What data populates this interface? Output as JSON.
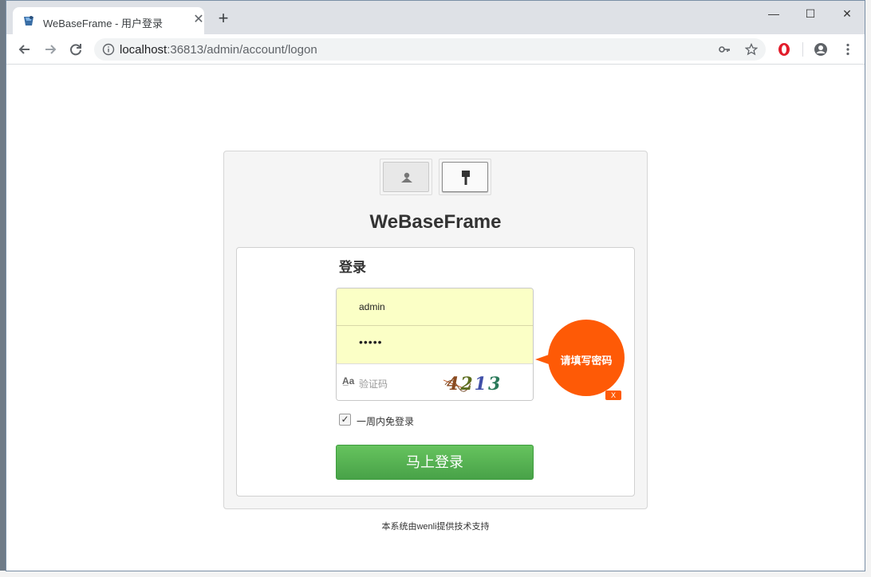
{
  "browser": {
    "tab_title": "WeBaseFrame - 用户登录",
    "tab_close": "✕",
    "new_tab": "+",
    "url_host": "localhost",
    "url_path": ":36813/admin/account/logon",
    "icons": [
      "back-icon",
      "forward-icon",
      "reload-icon",
      "info-icon",
      "key-icon",
      "star-icon",
      "opera-icon",
      "profile-icon",
      "menu-icon"
    ]
  },
  "window_controls": {
    "minimize": "—",
    "maximize": "☐",
    "close": "✕"
  },
  "login": {
    "brand": "WeBaseFrame",
    "form_title": "登录",
    "username_value": "admin",
    "password_value": "•••••",
    "captcha_placeholder": "验证码",
    "captcha_icon": "A̲a",
    "captcha_text": "4213",
    "tooltip": "请填写密码",
    "tooltip_close": "X",
    "remember_label": "一周内免登录",
    "remember_checked": true,
    "remember_mark": "✓",
    "submit_label": "马上登录"
  },
  "footer_text": "本系统由wenli提供技术支持",
  "colors": {
    "accent_green": "#4caf50",
    "tooltip_orange": "#fe5a06",
    "autofill_yellow": "#fbffc6"
  }
}
